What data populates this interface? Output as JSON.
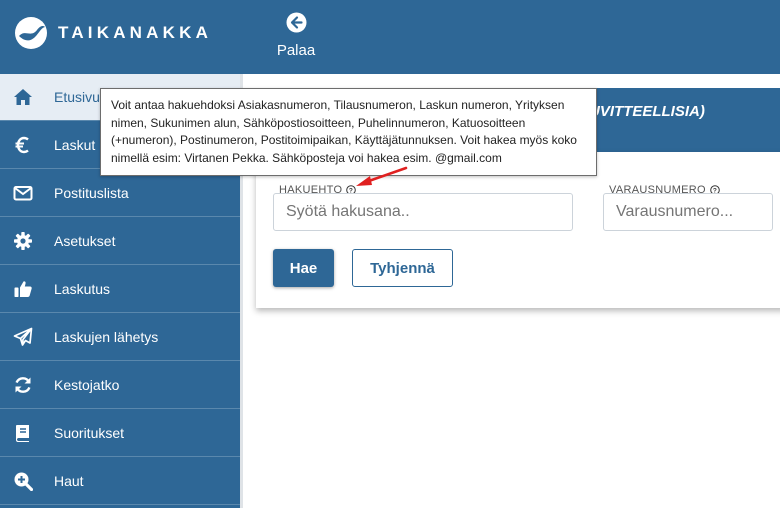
{
  "header": {
    "brand": "TAIKANAKKA",
    "back_label": "Palaa"
  },
  "sidebar": {
    "items": [
      {
        "label": "Etusivu",
        "icon": "home-icon"
      },
      {
        "label": "Laskut",
        "icon": "euro-icon"
      },
      {
        "label": "Postituslista",
        "icon": "envelope-icon"
      },
      {
        "label": "Asetukset",
        "icon": "gear-icon"
      },
      {
        "label": "Laskutus",
        "icon": "thumbs-up-icon"
      },
      {
        "label": "Laskujen lähetys",
        "icon": "paper-plane-icon"
      },
      {
        "label": "Kestojatko",
        "icon": "refresh-icon"
      },
      {
        "label": "Suoritukset",
        "icon": "book-icon"
      },
      {
        "label": "Haut",
        "icon": "search-plus-icon"
      }
    ]
  },
  "main": {
    "banner_text": "(TIEDOT KUVITTEELLISIA)",
    "search": {
      "label": "HAKUEHTO",
      "placeholder": "Syötä hakusana.."
    },
    "reservation": {
      "label": "VARAUSNUMERO",
      "placeholder": "Varausnumero..."
    },
    "search_button": "Hae",
    "clear_button": "Tyhjennä"
  },
  "tooltip": {
    "text": "Voit antaa hakuehdoksi Asiakasnumeron, Tilausnumeron, Laskun numeron, Yrityksen nimen, Sukunimen alun, Sähköpostiosoitteen, Puhelinnumeron, Katuosoitteen (+numeron), Postinumeron, Postitoimipaikan, Käyttäjätunnuksen. Voit hakea myös koko nimellä esim: Virtanen Pekka. Sähköposteja voi hakea esim. @gmail.com"
  },
  "colors": {
    "primary": "#2e6796",
    "active_bg": "#e6edf4",
    "arrow": "#e02020"
  }
}
